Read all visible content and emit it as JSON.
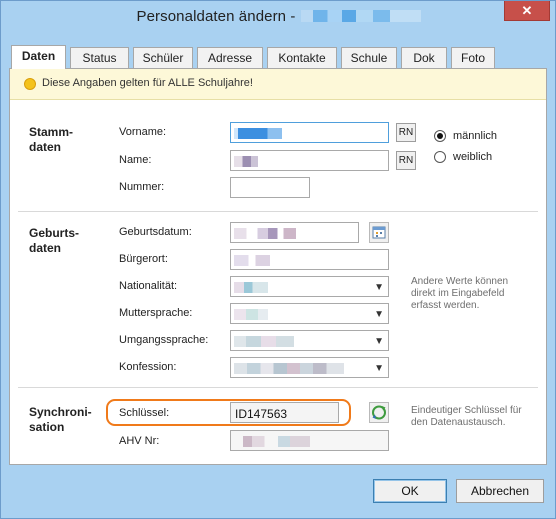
{
  "window": {
    "title": "Personaldaten ändern -",
    "close_glyph": "✕"
  },
  "tabs": [
    "Daten",
    "Status",
    "Schüler",
    "Adresse",
    "Kontakte",
    "Schule",
    "Dok",
    "Foto"
  ],
  "banner": {
    "text": "Diese Angaben gelten für ALLE Schuljahre!"
  },
  "stammdaten": {
    "title_line1": "Stamm-",
    "title_line2": "daten",
    "vorname_label": "Vorname:",
    "name_label": "Name:",
    "nummer_label": "Nummer:",
    "rn_label": "RN",
    "gender": {
      "maennlich": "männlich",
      "weiblich": "weiblich",
      "selected": "männlich"
    }
  },
  "geburtsdaten": {
    "title_line1": "Geburts-",
    "title_line2": "daten",
    "geburtsdatum_label": "Geburtsdatum:",
    "buergerort_label": "Bürgerort:",
    "nationalitaet_label": "Nationalität:",
    "muttersprache_label": "Muttersprache:",
    "umgangssprache_label": "Umgangssprache:",
    "konfession_label": "Konfession:",
    "hint": [
      "Andere Werte können",
      "direkt im Eingabefeld",
      "erfasst werden."
    ]
  },
  "synchronisation": {
    "title_line1": "Synchroni-",
    "title_line2": "sation",
    "schluessel_label": "Schlüssel:",
    "schluessel_value": "ID147563",
    "ahv_label": "AHV Nr:",
    "hint": [
      "Eindeutiger Schlüssel für",
      "den Datenaustausch."
    ]
  },
  "footer": {
    "ok": "OK",
    "abbrechen": "Abbrechen"
  },
  "icons": {
    "calendar": "calendar-icon",
    "sync": "sync-icon"
  },
  "colors": {
    "accent": "#4f9fdc",
    "highlight": "#f07a1a",
    "banner_bg": "#fdf8d8",
    "window_bg": "#a9d1f1"
  }
}
